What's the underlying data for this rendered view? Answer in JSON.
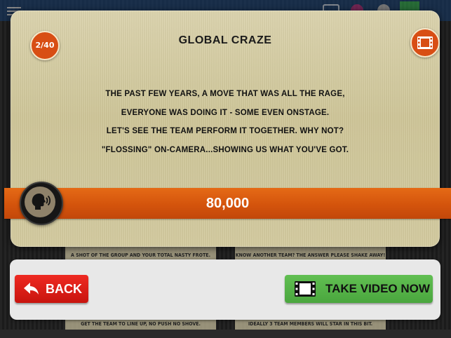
{
  "challenge": {
    "counter": "2/40",
    "title": "GLOBAL CRAZE",
    "lines": [
      "THE PAST FEW YEARS, A MOVE THAT WAS ALL THE RAGE,",
      "EVERYONE WAS DOING IT - SOME EVEN ONSTAGE.",
      "LET'S SEE THE TEAM PERFORM IT TOGETHER. WHY NOT?",
      "\"FLOSSING\" ON-CAMERA...SHOWING US WHAT YOU'VE GOT."
    ],
    "points": "80,000"
  },
  "actions": {
    "back_label": "BACK",
    "video_label": "TAKE VIDEO NOW"
  },
  "background_cards": {
    "left_top": "A SHOT OF THE GROUP AND YOUR TOTAL NASTY FROTE.",
    "right_top": "KNOW ANOTHER TEAM? THE ANSWER PLEASE SHAKE AWAY!",
    "left_bottom": "GET THE TEAM TO LINE UP, NO PUSH NO SHOVE.",
    "right_bottom": "IDEALLY 3 TEAM MEMBERS WILL STAR IN THIS BIT."
  },
  "icons": {
    "counter": "badge",
    "film": "film-icon",
    "audio": "speaking-head-icon",
    "back": "back-arrow-icon",
    "video": "film-icon"
  },
  "colors": {
    "accent_orange": "#d84e14",
    "back_red": "#e31e18",
    "video_green": "#55b548",
    "card_gold": "#d3ca9e"
  }
}
